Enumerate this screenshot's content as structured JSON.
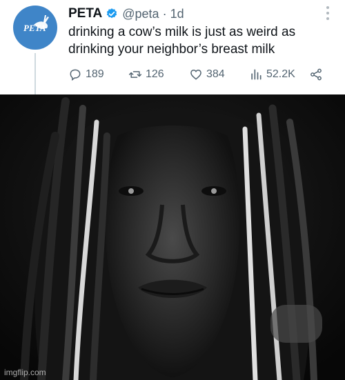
{
  "tweet": {
    "display_name": "PETA",
    "handle_time": "@peta · 1d",
    "text_line1": "drinking a cow’s milk is just as weird as",
    "text_line2": "drinking your neighbor’s breast milk",
    "avatar_text": "PETA",
    "replies": "189",
    "retweets": "126",
    "likes": "384",
    "views": "52.2K"
  },
  "icons": {
    "verified": "verified-badge-icon",
    "more": "more-dots-icon",
    "reply": "reply-icon",
    "retweet": "retweet-icon",
    "like": "heart-icon",
    "views": "views-chart-icon",
    "share": "share-icon"
  },
  "watermark": "imgflip.com",
  "colors": {
    "verified_blue": "#1d9bf0",
    "avatar_blue": "#3f85c8",
    "secondary_text": "#536471"
  }
}
